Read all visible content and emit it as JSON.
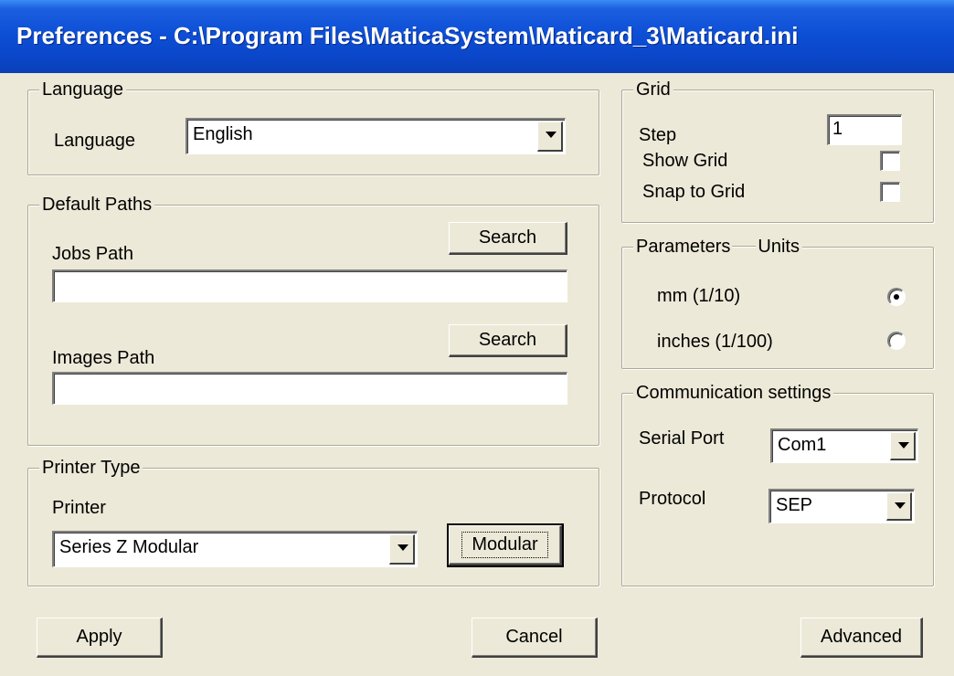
{
  "window": {
    "title": "Preferences - C:\\Program Files\\MaticaSystem\\Maticard_3\\Maticard.ini"
  },
  "language": {
    "group_label": "Language",
    "field_label": "Language",
    "selected": "English"
  },
  "default_paths": {
    "group_label": "Default Paths",
    "jobs_label": "Jobs Path",
    "jobs_value": "",
    "images_label": "Images Path",
    "images_value": "",
    "search_label": "Search"
  },
  "printer_type": {
    "group_label": "Printer Type",
    "printer_label": "Printer",
    "selected": "Series Z Modular",
    "modular_label": "Modular"
  },
  "grid": {
    "group_label": "Grid",
    "step_label": "Step",
    "step_value": "1",
    "show_grid_label": "Show Grid",
    "show_grid_checked": false,
    "snap_label": "Snap to Grid",
    "snap_checked": false
  },
  "parameters": {
    "group_label": "Parameters",
    "units_label": "Units",
    "options": [
      {
        "label": "mm (1/10)",
        "selected": true
      },
      {
        "label": "inches (1/100)",
        "selected": false
      }
    ]
  },
  "communication": {
    "group_label": "Communication settings",
    "serial_label": "Serial Port",
    "serial_value": "Com1",
    "protocol_label": "Protocol",
    "protocol_value": "SEP"
  },
  "buttons": {
    "apply": "Apply",
    "cancel": "Cancel",
    "advanced": "Advanced"
  }
}
